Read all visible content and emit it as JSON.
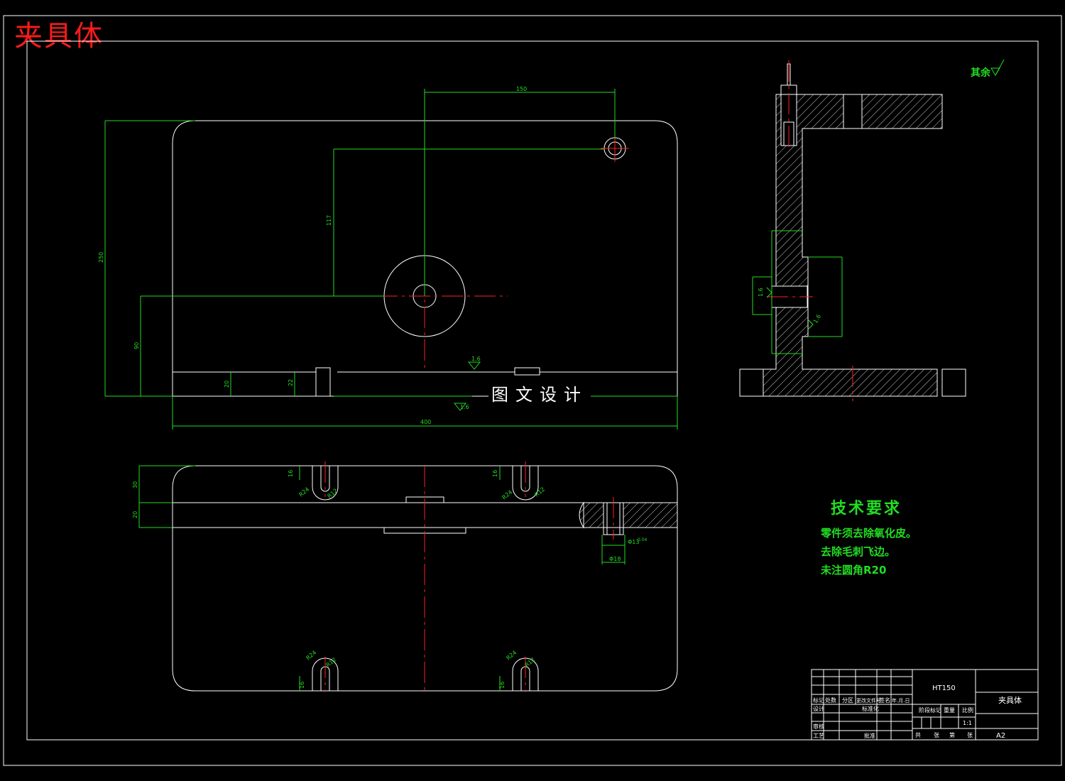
{
  "title": "夹具体",
  "watermark": "图文设计",
  "roughness_note": "其余",
  "tech_requirements": {
    "title": "技术要求",
    "lines": [
      "零件须去除氧化皮。",
      "去除毛刺飞边。",
      "未注圆角R20"
    ]
  },
  "dimensions": {
    "top_width": "150",
    "vert_117": "117",
    "height_250": "250",
    "height_90": "90",
    "base_20": "20",
    "base_22": "22",
    "rough_16": "1.6",
    "overall_width": "400",
    "slot_16": "16",
    "bottom_20": "20",
    "bottom_30": "30",
    "phi13": "Φ13",
    "phi18": "Φ18",
    "tol": "0.04",
    "r24": "R24",
    "r12": "R12"
  },
  "title_block": {
    "material": "HT150",
    "part_name": "夹具体",
    "scale": "1:1",
    "sheet": "A2",
    "row_headers": [
      "标记",
      "处数",
      "分区",
      "更改文件号",
      "签名",
      "年.月.日"
    ],
    "labels": {
      "design": "设计",
      "standardize": "标准化",
      "check": "审核",
      "process": "工艺",
      "approve": "批准",
      "stage_mark": "阶段标记",
      "weight": "重量",
      "scale_label": "比例",
      "total": "共",
      "sheets": "张",
      "page": "第",
      "pages": "张"
    }
  },
  "colors": {
    "background": "#000000",
    "outline": "#ffffff",
    "dimension": "#22dd22",
    "centerline": "#ff2222",
    "title": "#ff1a1a"
  }
}
